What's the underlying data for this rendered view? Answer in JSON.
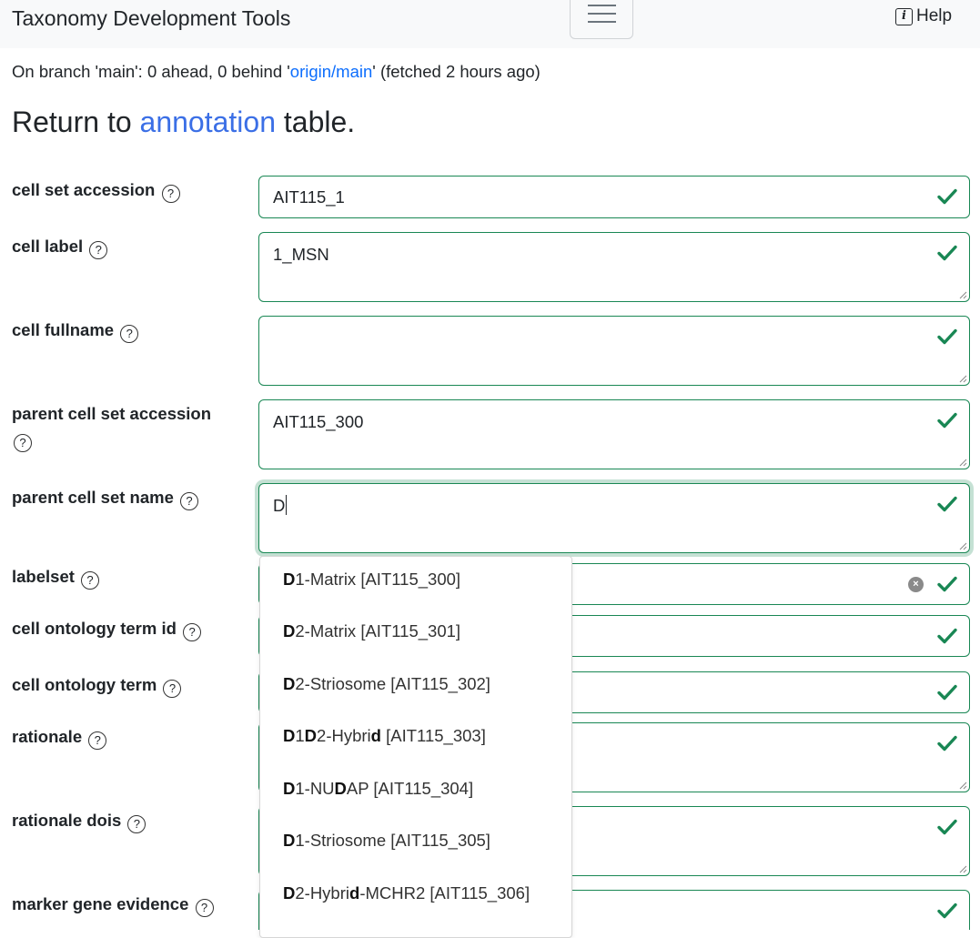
{
  "navbar": {
    "brand": "Taxonomy Development Tools",
    "help_label": "Help",
    "help_icon": "i"
  },
  "branch_status": {
    "prefix": "On branch 'main': 0 ahead, 0 behind '",
    "link": "origin/main",
    "suffix": "' (fetched 2 hours ago)"
  },
  "heading": {
    "prefix": "Return to ",
    "link": "annotation",
    "suffix": " table."
  },
  "help_glyph": "?",
  "fields": [
    {
      "label": "cell set accession",
      "value": "AIT115_1"
    },
    {
      "label": "cell label",
      "value": "1_MSN"
    },
    {
      "label": "cell fullname",
      "value": ""
    },
    {
      "label": "parent cell set accession",
      "value": "AIT115_300"
    },
    {
      "label": "parent cell set name",
      "value": "D"
    },
    {
      "label": "labelset",
      "value": ""
    },
    {
      "label": "cell ontology term id",
      "value": ""
    },
    {
      "label": "cell ontology term",
      "value": ""
    },
    {
      "label": "rationale",
      "value": ""
    },
    {
      "label": "rationale dois",
      "value": ""
    },
    {
      "label": "marker gene evidence",
      "value": ""
    }
  ],
  "clear_glyph": "×",
  "dropdown": [
    [
      {
        "t": "D",
        "b": true
      },
      {
        "t": "1-Matrix [AIT115_300]",
        "b": false
      }
    ],
    [
      {
        "t": "D",
        "b": true
      },
      {
        "t": "2-Matrix [AIT115_301]",
        "b": false
      }
    ],
    [
      {
        "t": "D",
        "b": true
      },
      {
        "t": "2-Striosome [AIT115_302]",
        "b": false
      }
    ],
    [
      {
        "t": "D",
        "b": true
      },
      {
        "t": "1",
        "b": false
      },
      {
        "t": "D",
        "b": true
      },
      {
        "t": "2-Hybri",
        "b": false
      },
      {
        "t": "d",
        "b": true
      },
      {
        "t": " [AIT115_303]",
        "b": false
      }
    ],
    [
      {
        "t": "D",
        "b": true
      },
      {
        "t": "1-NU",
        "b": false
      },
      {
        "t": "D",
        "b": true
      },
      {
        "t": "AP [AIT115_304]",
        "b": false
      }
    ],
    [
      {
        "t": "D",
        "b": true
      },
      {
        "t": "1-Striosome [AIT115_305]",
        "b": false
      }
    ],
    [
      {
        "t": "D",
        "b": true
      },
      {
        "t": "2-Hybri",
        "b": false
      },
      {
        "t": "d",
        "b": true
      },
      {
        "t": "-MCHR2 [AIT115_306]",
        "b": false
      }
    ]
  ],
  "colors": {
    "valid": "#198754",
    "link": "#0d6efd"
  }
}
